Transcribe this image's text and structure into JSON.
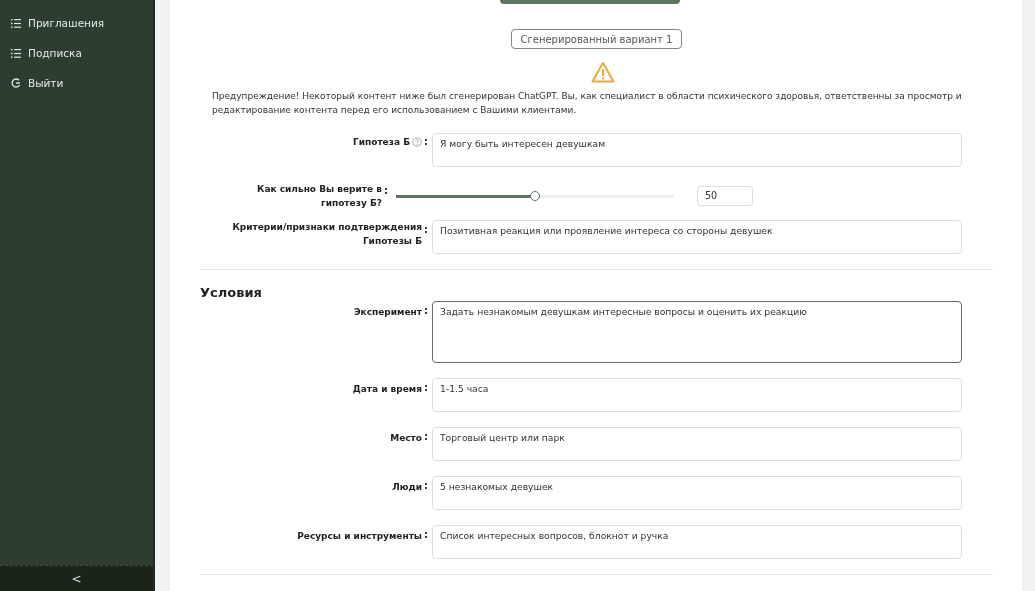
{
  "sidebar": {
    "items": [
      {
        "label": "Приглашения",
        "kind": "list"
      },
      {
        "label": "Подписка",
        "kind": "list"
      },
      {
        "label": "Выйти",
        "kind": "logout"
      }
    ],
    "collapse": "<"
  },
  "variant_button": "Сгенерированный вариант 1",
  "warning": "Предупреждение! Некоторый контент ниже был сгенерирован ChatGPT. Вы, как специалист в области психического здоровья, ответственны за просмотр и редактирование контента перед его использованием с Вашими клиентами.",
  "hypothesis": {
    "label": "Гипотеза Б",
    "colon": ":",
    "value": "Я могу быть интересен девушкам"
  },
  "belief": {
    "label": "Как сильно Вы верите в гипотезу Б?",
    "colon": ":",
    "level": 0.5,
    "value": "50"
  },
  "criteria": {
    "label": "Критерии/признаки подтверждения Гипотезы Б",
    "colon": ":",
    "value": "Позитивная реакция или проявление интереса со стороны девушек"
  },
  "conditions": {
    "title": "Условия",
    "fields": [
      {
        "label": "Эксперимент",
        "colon": ":",
        "value": "Задать незнакомым девушкам интересные вопросы и оценить их реакцию",
        "focused": true,
        "tall": true
      },
      {
        "label": "Дата и время",
        "colon": ":",
        "value": "1-1.5 часа",
        "focused": false,
        "tall": false
      },
      {
        "label": "Место",
        "colon": ":",
        "value": "Торговый центр или парк",
        "focused": false,
        "tall": false
      },
      {
        "label": "Люди",
        "colon": ":",
        "value": "5 незнакомых девушек",
        "focused": false,
        "tall": false
      },
      {
        "label": "Ресурсы и инструменты",
        "colon": ":",
        "value": "Список интересных вопросов, блокнот и ручка",
        "focused": false,
        "tall": false
      }
    ]
  }
}
